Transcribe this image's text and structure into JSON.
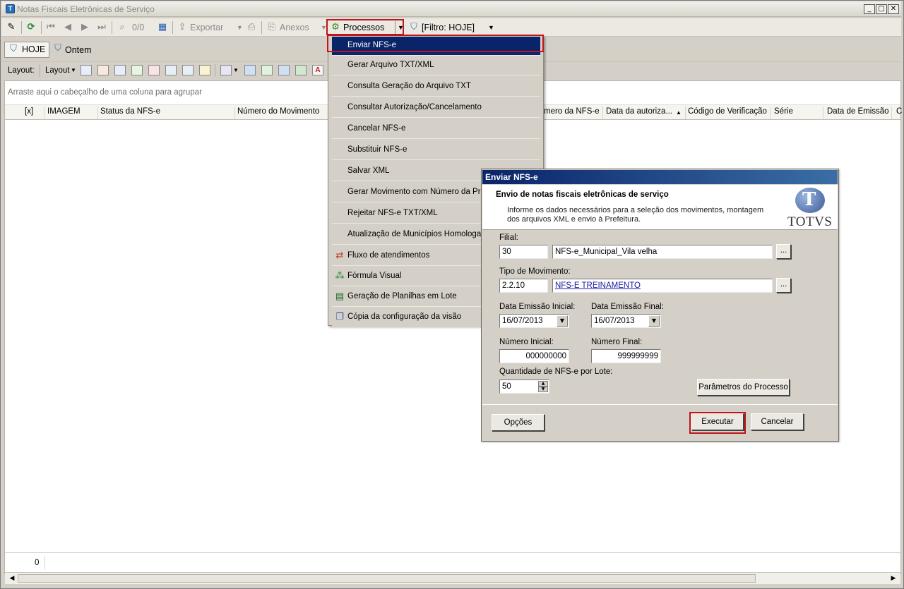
{
  "window": {
    "title": "Notas Fiscais Eletrônicas de Serviço"
  },
  "toolbar": {
    "record_count": "0/0",
    "export_label": "Exportar",
    "attachments_label": "Anexos",
    "processes_label": "Processos",
    "filter_label": "[Filtro: HOJE]"
  },
  "views": {
    "today_label": "HOJE",
    "yesterday_label": "Ontem"
  },
  "layout_bar": {
    "label": "Layout:",
    "menu_label": "Layout"
  },
  "grid": {
    "group_hint": "Arraste aqui o cabeçalho de uma coluna para agrupar",
    "columns": [
      "[x]",
      "IMAGEM",
      "Status da NFS-e",
      "Número do Movimento",
      "mero da NFS-e",
      "Data da autoriza...",
      "Código de Verificação",
      "Série",
      "Data de Emissão",
      "C"
    ],
    "footer_count": "0"
  },
  "menu": {
    "items": [
      "Enviar NFS-e",
      "Gerar Arquivo TXT/XML",
      "Consulta Geração do Arquivo TXT",
      "Consultar Autorização/Cancelamento",
      "Cancelar NFS-e",
      "Substituir NFS-e",
      "Salvar XML",
      "Gerar Movimento com Número da Prefei",
      "Rejeitar NFS-e TXT/XML",
      "Atualização de Municípios Homologados",
      "Fluxo de atendimentos",
      "Fórmula Visual",
      "Geração de Planilhas em Lote",
      "Cópia da configuração da visão"
    ]
  },
  "dialog": {
    "title": "Enviar NFS-e",
    "heading": "Envio de notas fiscais eletrônicas de serviço",
    "description": "Informe os dados necessários para a seleção dos movimentos, montagem dos arquivos XML e envio à Prefeitura.",
    "logo_text": "TOTVS",
    "filial_label": "Filial:",
    "filial_code": "30",
    "filial_name": "NFS-e_Municipal_Vila velha",
    "tipo_label": "Tipo de Movimento:",
    "tipo_code": "2.2.10",
    "tipo_name": "NFS-E TREINAMENTO",
    "data_inicial_label": "Data Emissão Inicial:",
    "data_inicial": "16/07/2013",
    "data_final_label": "Data Emissão Final:",
    "data_final": "16/07/2013",
    "num_inicial_label": "Número Inicial:",
    "num_inicial": "000000000",
    "num_final_label": "Número Final:",
    "num_final": "999999999",
    "qtd_label": "Quantidade de NFS-e por Lote:",
    "qtd": "50",
    "params_button": "Parâmetros do Processo",
    "browse_button": "...",
    "options_button": "Opções",
    "execute_button": "Executar",
    "cancel_button": "Cancelar"
  },
  "colors": {
    "selection": "#0a246a",
    "highlight_border": "#c0151b",
    "dialog_title": "#0a246a"
  }
}
